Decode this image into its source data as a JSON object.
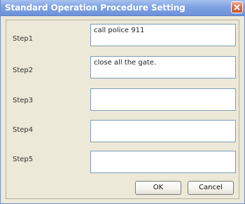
{
  "window": {
    "title": "Standard Operation Procedure Setting"
  },
  "steps": [
    {
      "label": "Step1",
      "value": "call police 911"
    },
    {
      "label": "Step2",
      "value": "close all the gate."
    },
    {
      "label": "Step3",
      "value": ""
    },
    {
      "label": "Step4",
      "value": ""
    },
    {
      "label": "Step5",
      "value": ""
    }
  ],
  "buttons": {
    "ok_label": "OK",
    "cancel_label": "Cancel"
  },
  "icons": {
    "close": "close-icon"
  }
}
